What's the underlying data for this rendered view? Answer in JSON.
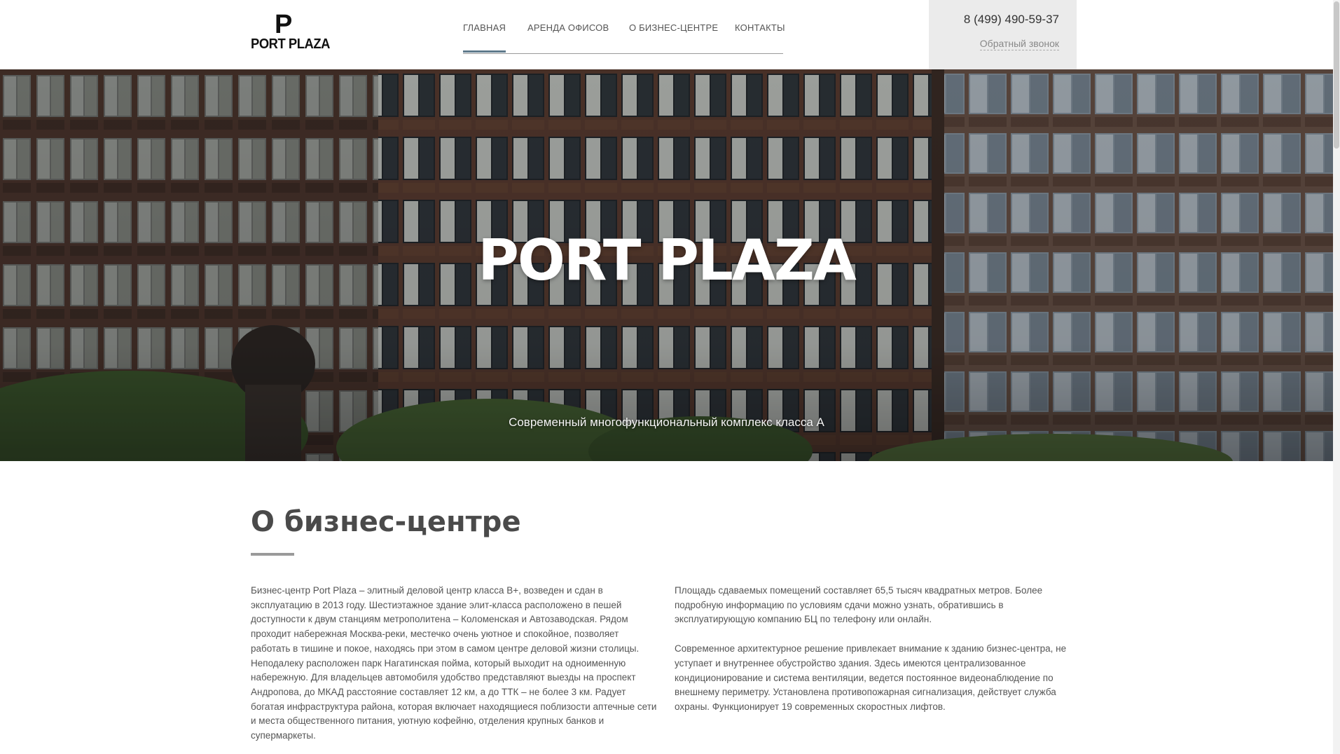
{
  "header": {
    "logo_mark": "P",
    "logo_text": "PORT PLAZA",
    "nav": [
      {
        "label": "ГЛАВНАЯ",
        "active": true
      },
      {
        "label": "АРЕНДА ОФИСОВ",
        "active": false
      },
      {
        "label": "О БИЗНЕС-ЦЕНТРЕ",
        "active": false
      },
      {
        "label": "КОНТАКТЫ",
        "active": false
      }
    ],
    "phone": "8 (499) 490-59-37",
    "callback_label": "Обратный звонок"
  },
  "hero": {
    "title": "PORT PLAZA",
    "subtitle": "Современный многофункциональный комплекс класса А"
  },
  "about": {
    "title": "О бизнес-центре",
    "left_paragraphs": [
      "Бизнес-центр Port Plaza – элитный деловой центр класса В+, возведен и сдан в эксплуатацию в 2013 году. Шестиэтажное здание элит-класса расположено в пешей доступности к двум станциям метрополитена – Коломенская и Автозаводская. Рядом проходит набережная Москва-реки, местечко очень уютное и спокойное, позволяет работать в тишине и покое, находясь при этом в самом центре деловой жизни столицы. Неподалеку расположен парк Нагатинская пойма, который выходит на одноименную набережную. Для владельцев автомобиля удобство представляют выезды на проспект Андропова, до МКАД расстояние составляет 12 км, а до ТТК – не более 3 км. Радует богатая инфраструктура района, которая включает находящиеся поблизости аптечные сети и места общественного питания, уютную кофейню, отделения крупных банков и супермаркеты."
    ],
    "right_paragraphs": [
      "Площадь сдаваемых помещений составляет 65,5 тысяч квадратных метров. Более подробную информацию по условиям сдачи можно узнать, обратившись в эксплуатирующую компанию БЦ по телефону или онлайн.",
      "Современное архитектурное решение привлекает внимание к зданию бизнес-центра, не уступает и внутреннее обустройство здания. Здесь имеются централизованное кондиционирование и система вентиляции, ведется постоянное видеонаблюдение по внешнему периметру. Установлена противопожарная сигнализация, действует служба охраны. Функционирует 19 современных скоростных лифтов."
    ]
  },
  "colors": {
    "nav_active_underline": "#5f7a8c",
    "contact_box_bg": "#ebebeb",
    "hero_brick": "#5e3a2c"
  }
}
